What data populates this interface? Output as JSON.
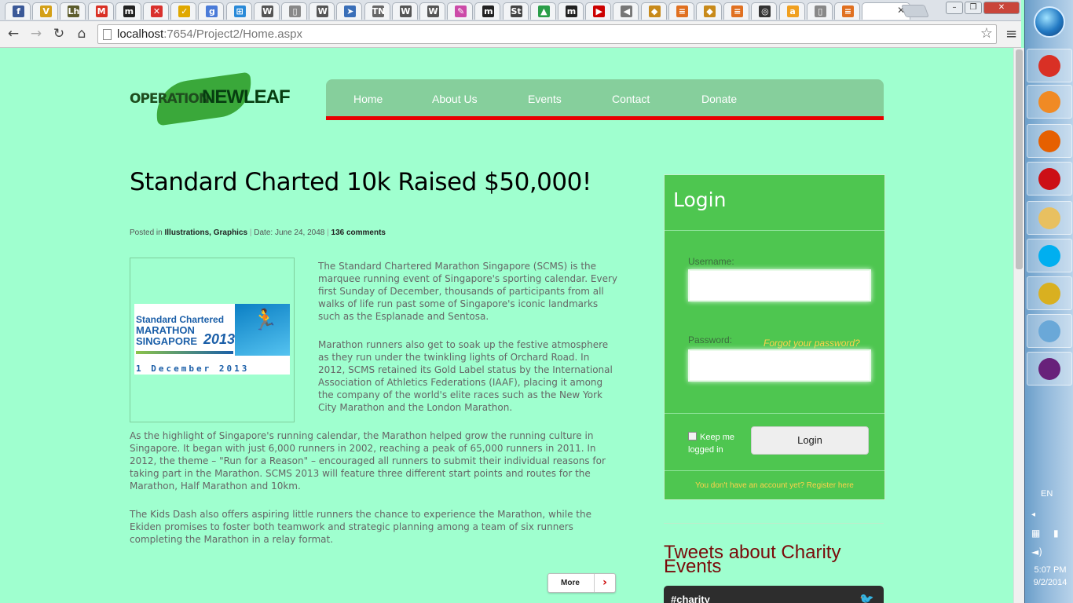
{
  "browser": {
    "tabs": [
      {
        "icon": "facebook-icon",
        "glyph": "f",
        "color": "#3b5998"
      },
      {
        "icon": "vimeo-icon",
        "glyph": "V",
        "color": "#d4a017"
      },
      {
        "icon": "lh-icon",
        "glyph": "Lh",
        "color": "#5c5c2c"
      },
      {
        "icon": "gmail-icon",
        "glyph": "M",
        "color": "#d93025"
      },
      {
        "icon": "m-icon",
        "glyph": "m",
        "color": "#222222"
      },
      {
        "icon": "close-red-icon",
        "glyph": "✕",
        "color": "#d9302c"
      },
      {
        "icon": "checkmark-icon",
        "glyph": "✓",
        "color": "#e0a800"
      },
      {
        "icon": "google-icon",
        "glyph": "g",
        "color": "#4a7bd8"
      },
      {
        "icon": "windows-icon",
        "glyph": "⊞",
        "color": "#2a8ad8"
      },
      {
        "icon": "wikipedia-icon",
        "glyph": "W",
        "color": "#555555"
      },
      {
        "icon": "page-icon",
        "glyph": "▯",
        "color": "#888888"
      },
      {
        "icon": "wikipedia-icon",
        "glyph": "W",
        "color": "#555555"
      },
      {
        "icon": "bird-icon",
        "glyph": "➤",
        "color": "#3a6fb8"
      },
      {
        "icon": "tn-icon",
        "glyph": "TN",
        "color": "#666666"
      },
      {
        "icon": "wikipedia-icon",
        "glyph": "W",
        "color": "#555555"
      },
      {
        "icon": "wikipedia-icon",
        "glyph": "W",
        "color": "#555555"
      },
      {
        "icon": "pencil-icon",
        "glyph": "✎",
        "color": "#cc4aa8"
      },
      {
        "icon": "m-icon",
        "glyph": "m",
        "color": "#222222"
      },
      {
        "icon": "st-icon",
        "glyph": "St",
        "color": "#444444"
      },
      {
        "icon": "drive-icon",
        "glyph": "▲",
        "color": "#2a9d48"
      },
      {
        "icon": "m-icon",
        "glyph": "m",
        "color": "#222222"
      },
      {
        "icon": "youtube-icon",
        "glyph": "▶",
        "color": "#cc0000"
      },
      {
        "icon": "speaker-icon",
        "glyph": "◀",
        "color": "#777777"
      },
      {
        "icon": "badge-icon",
        "glyph": "◆",
        "color": "#c88a1a"
      },
      {
        "icon": "stack-icon",
        "glyph": "≡",
        "color": "#e07020"
      },
      {
        "icon": "badge-icon",
        "glyph": "◆",
        "color": "#c88a1a"
      },
      {
        "icon": "stack-icon",
        "glyph": "≡",
        "color": "#e07020"
      },
      {
        "icon": "circle-icon",
        "glyph": "◎",
        "color": "#333333"
      },
      {
        "icon": "orange-icon",
        "glyph": "a",
        "color": "#f0a020"
      },
      {
        "icon": "page-icon",
        "glyph": "▯",
        "color": "#888888"
      },
      {
        "icon": "stack-icon",
        "glyph": "≡",
        "color": "#e07020"
      }
    ],
    "url_host": "localhost",
    "url_path": ":7654/Project2/Home.aspx"
  },
  "site": {
    "logo": {
      "part1": "OPERATION",
      "part2": "NEWLEAF"
    },
    "nav": [
      "Home",
      "About Us",
      "Events",
      "Contact",
      "Donate"
    ],
    "article": {
      "title": "Standard Charted 10k Raised $50,000!",
      "meta": {
        "posted_in": "Posted in",
        "cat1": "Illustrations",
        "comma": ",",
        "cat2": "Graphics",
        "date": "Date: June 24, 2048",
        "comments": "136 comments"
      },
      "banner": {
        "line1": "Standard Chartered",
        "line2": "MARATHON",
        "line3": "SINGAPORE",
        "year": "2013",
        "date": "1 December 2013"
      },
      "p1": "The Standard Chartered Marathon Singapore (SCMS) is the marquee running event of Singapore's sporting calendar. Every first Sunday of December, thousands of participants from all walks of life run past some of Singapore's iconic landmarks such as the Esplanade and Sentosa.",
      "p2": "Marathon runners also get to soak up the festive atmosphere as they run under the twinkling lights of Orchard Road. In 2012, SCMS retained its Gold Label status by the International Association of Athletics Federations (IAAF), placing it among the company of the world's elite races such as the New York City Marathon and the London Marathon.",
      "p3": "As the highlight of Singapore's running calendar, the Marathon helped grow the running culture in Singapore. It began with just 6,000 runners in 2002, reaching a peak of 65,000 runners in 2011. In 2012, the theme – \"Run for a Reason\" – encouraged all runners to submit their individual reasons for taking part in the Marathon. SCMS 2013 will feature three different start points and routes for the Marathon, Half Marathon and 10km.",
      "p4": "The Kids Dash also offers aspiring little runners the chance to experience the Marathon, while the Ekiden promises to foster both teamwork and strategic planning among a team of six runners completing the Marathon in a relay format.",
      "more": "More"
    },
    "login": {
      "title": "Login",
      "username_label": "Username:",
      "password_label": "Password:",
      "forgot": "Forgot your password?",
      "keep": "Keep me logged in",
      "button": "Login",
      "register": "You don't have an account yet? Register here"
    },
    "tweets": {
      "heading": "Tweets about Charity Events",
      "hashtag": "#charity"
    }
  },
  "taskbar": {
    "lang": "EN",
    "time": "5:07 PM",
    "date": "9/2/2014",
    "apps": [
      {
        "icon": "chrome-icon",
        "color": "#d93025"
      },
      {
        "icon": "media-player-icon",
        "color": "#f08a24"
      },
      {
        "icon": "firefox-icon",
        "color": "#e66000"
      },
      {
        "icon": "opera-icon",
        "color": "#cc0f16"
      },
      {
        "icon": "explorer-icon",
        "color": "#e8c060"
      },
      {
        "icon": "skype-icon",
        "color": "#00aff0"
      },
      {
        "icon": "tools-icon",
        "color": "#d9b020"
      },
      {
        "icon": "notepad-icon",
        "color": "#6aa8d8"
      },
      {
        "icon": "visual-studio-icon",
        "color": "#68217a"
      }
    ]
  }
}
